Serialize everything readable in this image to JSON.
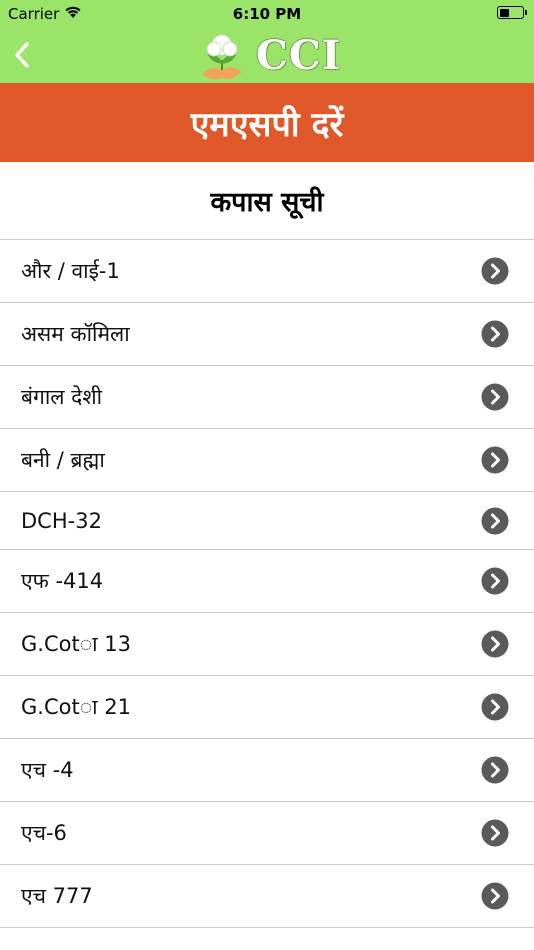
{
  "status_bar": {
    "carrier": "Carrier",
    "time": "6:10 PM",
    "battery_level": 0.45
  },
  "nav": {
    "brand": "CCI"
  },
  "header": {
    "title": "एमएसपी दरें"
  },
  "subheader": {
    "title": "कपास सूची"
  },
  "list": {
    "items": [
      "और / वाई-1",
      "असम कॉमिला",
      "बंगाल देशी",
      "बनी / ब्रह्मा",
      "DCH-32",
      "एफ -414",
      "G.Cotा 13",
      "G.Cotा 21",
      "एच -4",
      "एच-6",
      "एच 777"
    ]
  },
  "colors": {
    "nav_green": "#9be46a",
    "header_orange": "#e0572a",
    "chevron_gray": "#5a5a5a"
  }
}
